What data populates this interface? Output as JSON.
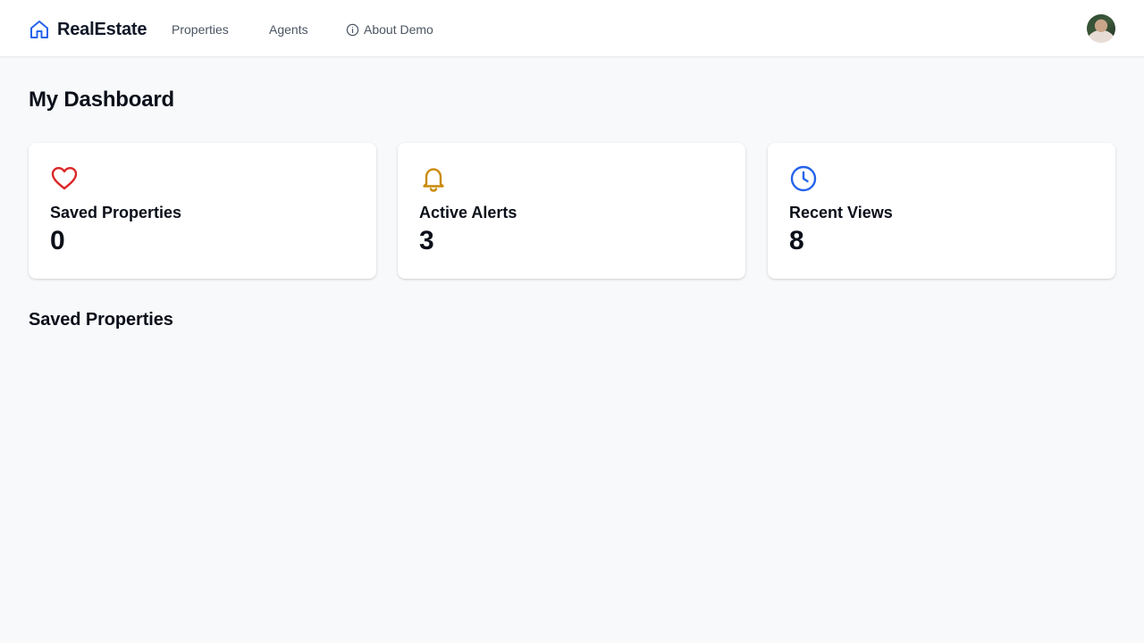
{
  "header": {
    "brand_name": "RealEstate",
    "brand_icon": "home-icon",
    "nav": [
      {
        "label": "Properties"
      },
      {
        "label": "Agents"
      },
      {
        "label": "About Demo",
        "icon": "info-icon"
      }
    ],
    "avatar": "user-avatar"
  },
  "main": {
    "title": "My Dashboard",
    "stats": [
      {
        "label": "Saved Properties",
        "value": "0",
        "icon": "heart-icon",
        "color": "#dc2626"
      },
      {
        "label": "Active Alerts",
        "value": "3",
        "icon": "bell-icon",
        "color": "#ca8a04"
      },
      {
        "label": "Recent Views",
        "value": "8",
        "icon": "clock-icon",
        "color": "#2563eb"
      }
    ],
    "section_title": "Saved Properties"
  },
  "colors": {
    "brand": "#2563eb",
    "background": "#f8f9fb",
    "card": "#ffffff",
    "nav_text": "#4b5563"
  }
}
